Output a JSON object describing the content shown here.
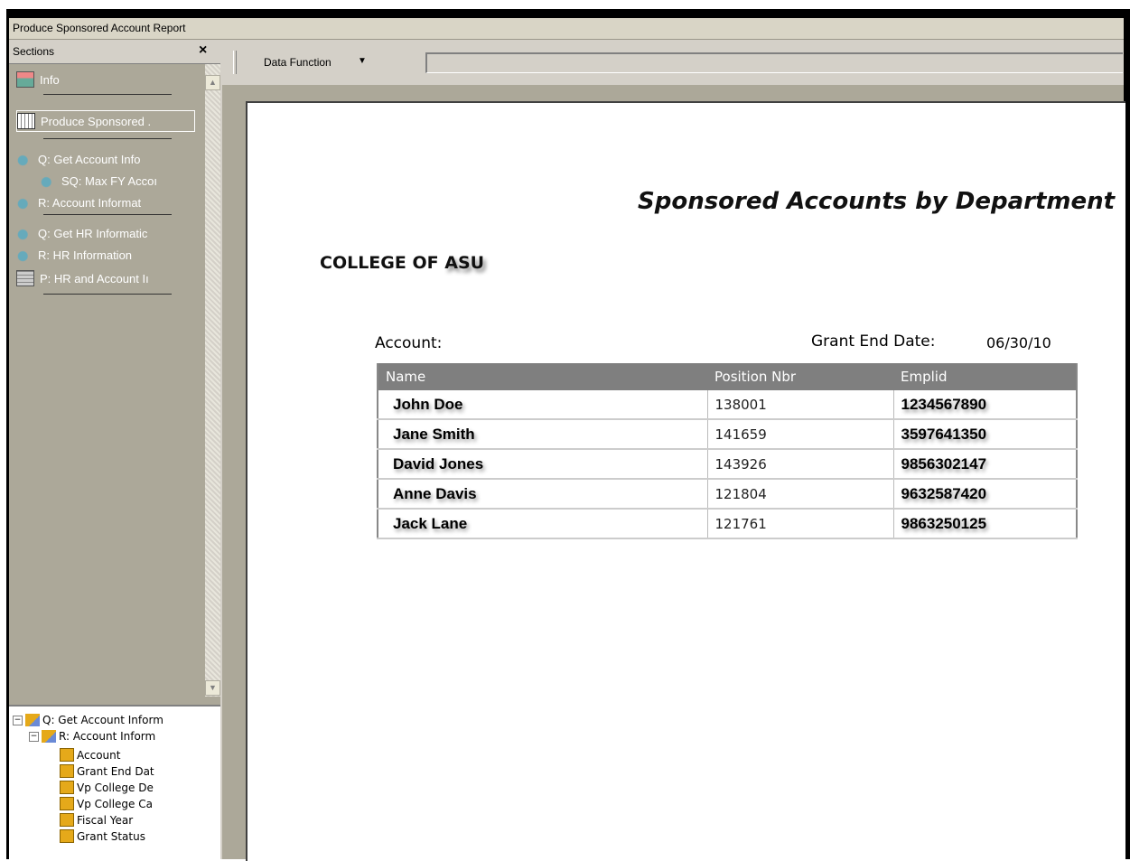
{
  "window": {
    "title": "Produce Sponsored Account Report"
  },
  "sections": {
    "header": "Sections",
    "close": "×",
    "items": [
      {
        "label": "Info",
        "icon": "info-icon"
      },
      {
        "label": "Produce Sponsored .",
        "icon": "report-icon"
      },
      {
        "label": "Q: Get Account Info",
        "icon": "query-icon"
      },
      {
        "label": "SQ: Max FY Accoı",
        "icon": "subquery-icon"
      },
      {
        "label": "R: Account Informat",
        "icon": "results-icon"
      },
      {
        "label": "Q: Get HR Informatic",
        "icon": "query-icon"
      },
      {
        "label": "R: HR Information",
        "icon": "results-icon"
      },
      {
        "label": "P: HR and Account Iı",
        "icon": "pivot-icon"
      }
    ]
  },
  "tree": {
    "items": [
      {
        "label": "Q: Get Account Inform"
      },
      {
        "label": "R: Account Inform"
      },
      {
        "label": "Account"
      },
      {
        "label": "Grant End Dat"
      },
      {
        "label": "Vp College De"
      },
      {
        "label": "Vp College Ca"
      },
      {
        "label": "Fiscal Year"
      },
      {
        "label": "Grant Status"
      }
    ]
  },
  "toolbar": {
    "data_function": "Data Function",
    "arrow": "▼"
  },
  "report": {
    "title": "Sponsored Accounts by Department",
    "college": "COLLEGE OF",
    "college_name": "ASU",
    "account_label": "Account:",
    "grant_end_label": "Grant End Date:",
    "grant_end_value": "06/30/10",
    "columns": [
      "Name",
      "Position Nbr",
      "Emplid"
    ],
    "rows": [
      [
        "John Doe",
        "138001",
        "1234567890"
      ],
      [
        "Jane  Smith",
        "141659",
        "3597641350"
      ],
      [
        "David Jones",
        "143926",
        "9856302147"
      ],
      [
        "Anne Davis",
        "121804",
        "9632587420"
      ],
      [
        "Jack Lane",
        "121761",
        "9863250125"
      ]
    ]
  },
  "colors": {
    "panel": "#aca899",
    "chrome": "#d4d0c8",
    "header_row": "#7f7f7f"
  }
}
